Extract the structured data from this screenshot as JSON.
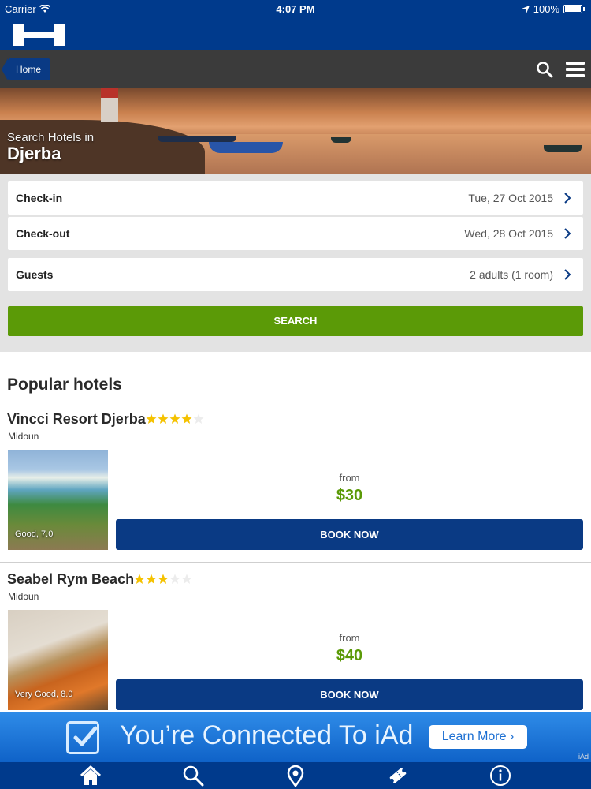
{
  "status_bar": {
    "carrier": "Carrier",
    "time": "4:07 PM",
    "battery": "100%"
  },
  "header": {
    "logo_icon": "hotel-h-logo"
  },
  "navbar": {
    "home_label": "Home",
    "search_icon": "search-icon",
    "menu_icon": "menu-icon"
  },
  "hero": {
    "subtitle": "Search Hotels in",
    "city": "Djerba"
  },
  "search_form": {
    "checkin": {
      "label": "Check-in",
      "value": "Tue, 27 Oct 2015"
    },
    "checkout": {
      "label": "Check-out",
      "value": "Wed, 28 Oct 2015"
    },
    "guests": {
      "label": "Guests",
      "value": "2 adults (1 room)"
    },
    "search_label": "SEARCH"
  },
  "popular": {
    "title": "Popular hotels",
    "hotels": [
      {
        "name": "Vincci Resort Djerba",
        "stars": 4,
        "stars_max": 5,
        "area": "Midoun",
        "rating": "Good, 7.0",
        "from_label": "from",
        "price": "$30",
        "book_label": "BOOK NOW"
      },
      {
        "name": "Seabel Rym Beach",
        "stars": 3,
        "stars_max": 5,
        "area": "Midoun",
        "rating": "Very Good, 8.0",
        "from_label": "from",
        "price": "$40",
        "book_label": "BOOK NOW"
      }
    ]
  },
  "iad": {
    "tagline": "You’re Connected To iAd",
    "learn_more": "Learn More ›",
    "mark": "iAd"
  },
  "tab_bar": {
    "icons": [
      "home-icon",
      "search-icon",
      "map-pin-icon",
      "deals-ticket-icon",
      "info-icon"
    ]
  },
  "colors": {
    "brand_blue": "#003a8c",
    "button_blue": "#0a3a84",
    "search_green": "#5b9a07",
    "price_green": "#5b9a07",
    "star_gold": "#f5c200"
  }
}
